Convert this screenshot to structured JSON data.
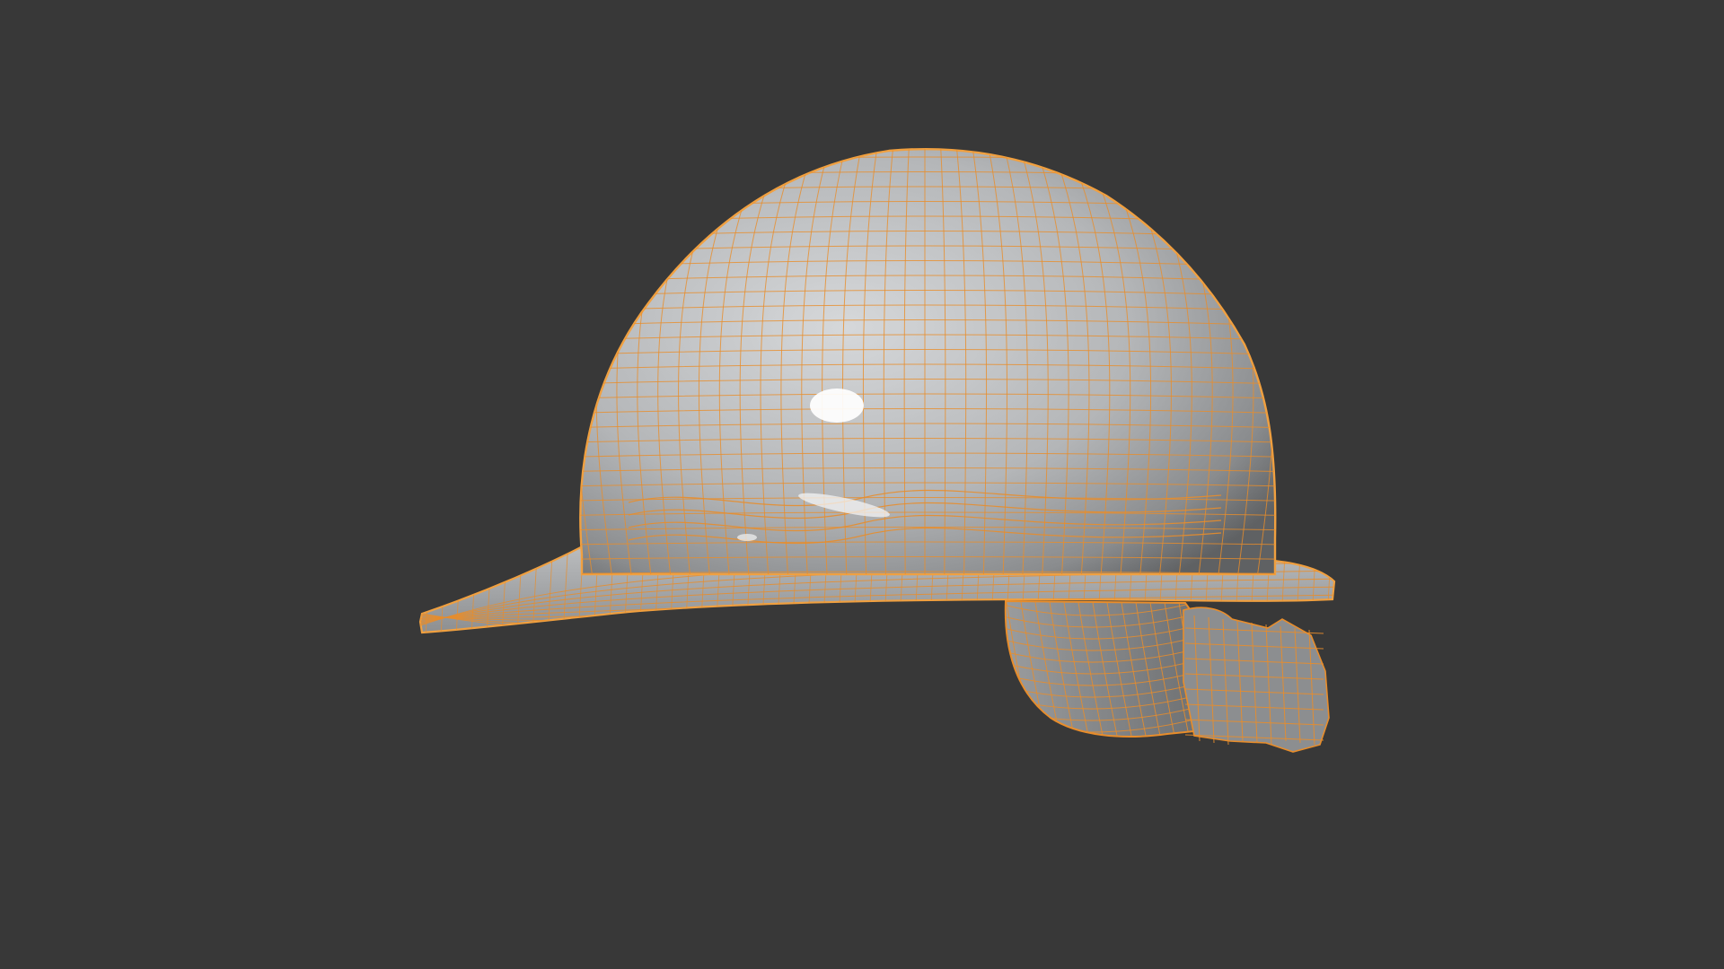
{
  "viewport": {
    "background_color": "#383838",
    "object": {
      "name": "hard-hat-helmet",
      "selected": true,
      "shading": "solid",
      "overlay": "wireframe"
    },
    "colors": {
      "shell_light": "#d2d4d6",
      "shell_mid": "#a9abad",
      "shell_dark": "#66686a",
      "wire": "#e88d2b",
      "outline": "#f0a040",
      "specular": "#ffffff"
    }
  }
}
